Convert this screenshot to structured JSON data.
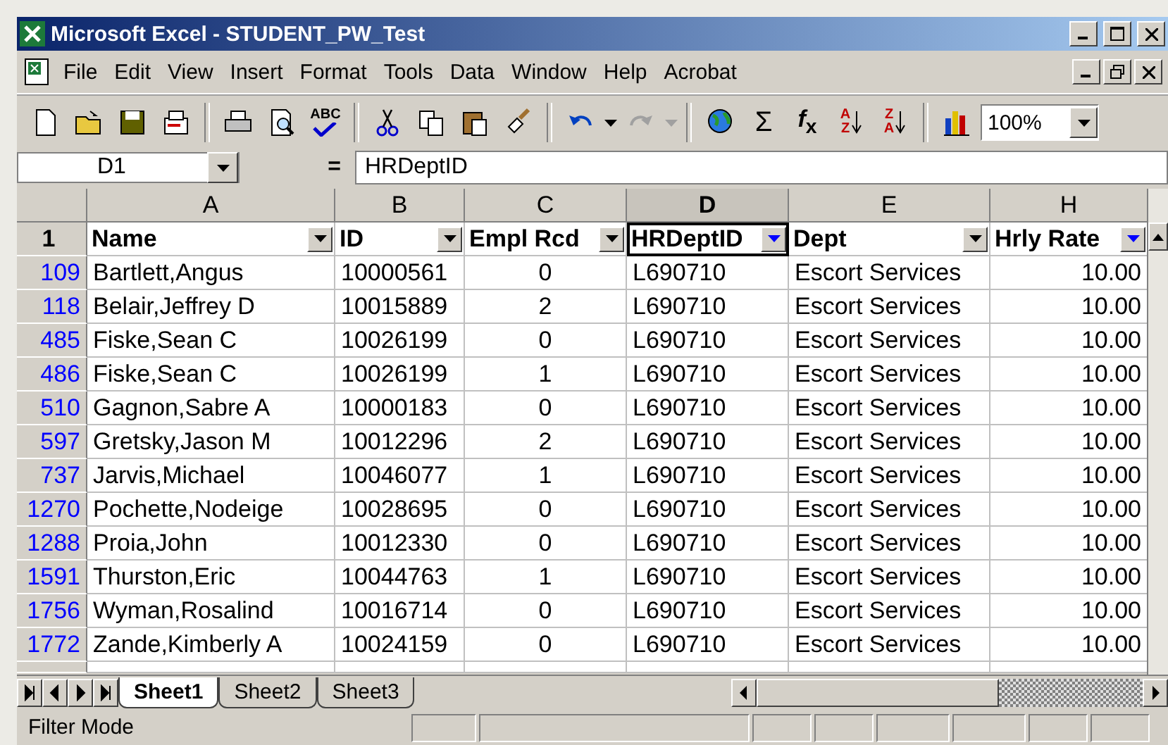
{
  "window": {
    "title": "Microsoft Excel - STUDENT_PW_Test"
  },
  "menu": [
    "File",
    "Edit",
    "View",
    "Insert",
    "Format",
    "Tools",
    "Data",
    "Window",
    "Help",
    "Acrobat"
  ],
  "toolbar": {
    "spelling_label": "ABC",
    "sum_label": "Σ",
    "function_label": "*f*$_{x}$",
    "sort_ascending": [
      "A",
      "Z"
    ],
    "sort_descending": [
      "Z",
      "A"
    ],
    "zoom": "100%"
  },
  "formula_bar": {
    "name_box": "D1",
    "equals": "=",
    "value": "HRDeptID"
  },
  "columns": [
    {
      "letter": "A",
      "selected": false
    },
    {
      "letter": "B",
      "selected": false
    },
    {
      "letter": "C",
      "selected": false
    },
    {
      "letter": "D",
      "selected": true
    },
    {
      "letter": "E",
      "selected": false
    },
    {
      "letter": "H",
      "selected": false
    }
  ],
  "header_row": {
    "number": "1",
    "fields": [
      {
        "label": "Name",
        "filtered": false,
        "selected": false
      },
      {
        "label": "ID",
        "filtered": false,
        "selected": false
      },
      {
        "label": "Empl Rcd",
        "filtered": false,
        "selected": false
      },
      {
        "label": "HRDeptID",
        "filtered": true,
        "selected": true
      },
      {
        "label": "Dept",
        "filtered": false,
        "selected": false
      },
      {
        "label": "Hrly Rate",
        "filtered": true,
        "selected": false
      }
    ]
  },
  "rows": [
    {
      "number": "109",
      "cells": [
        "Bartlett,Angus",
        "10000561",
        "0",
        "L690710",
        "Escort Services",
        "10.00"
      ]
    },
    {
      "number": "118",
      "cells": [
        "Belair,Jeffrey D",
        "10015889",
        "2",
        "L690710",
        "Escort Services",
        "10.00"
      ]
    },
    {
      "number": "485",
      "cells": [
        "Fiske,Sean C",
        "10026199",
        "0",
        "L690710",
        "Escort Services",
        "10.00"
      ]
    },
    {
      "number": "486",
      "cells": [
        "Fiske,Sean C",
        "10026199",
        "1",
        "L690710",
        "Escort Services",
        "10.00"
      ]
    },
    {
      "number": "510",
      "cells": [
        "Gagnon,Sabre A",
        "10000183",
        "0",
        "L690710",
        "Escort Services",
        "10.00"
      ]
    },
    {
      "number": "597",
      "cells": [
        "Gretsky,Jason M",
        "10012296",
        "2",
        "L690710",
        "Escort Services",
        "10.00"
      ]
    },
    {
      "number": "737",
      "cells": [
        "Jarvis,Michael",
        "10046077",
        "1",
        "L690710",
        "Escort Services",
        "10.00"
      ]
    },
    {
      "number": "1270",
      "cells": [
        "Pochette,Nodeige",
        "10028695",
        "0",
        "L690710",
        "Escort Services",
        "10.00"
      ]
    },
    {
      "number": "1288",
      "cells": [
        "Proia,John",
        "10012330",
        "0",
        "L690710",
        "Escort Services",
        "10.00"
      ]
    },
    {
      "number": "1591",
      "cells": [
        "Thurston,Eric",
        "10044763",
        "1",
        "L690710",
        "Escort Services",
        "10.00"
      ]
    },
    {
      "number": "1756",
      "cells": [
        "Wyman,Rosalind",
        "10016714",
        "0",
        "L690710",
        "Escort Services",
        "10.00"
      ]
    },
    {
      "number": "1772",
      "cells": [
        "Zande,Kimberly A",
        "10024159",
        "0",
        "L690710",
        "Escort Services",
        "10.00"
      ]
    }
  ],
  "sheet_tabs": [
    {
      "label": "Sheet1",
      "selected": true
    },
    {
      "label": "Sheet2",
      "selected": false
    },
    {
      "label": "Sheet3",
      "selected": false
    }
  ],
  "status_bar": {
    "mode": "Filter Mode"
  }
}
